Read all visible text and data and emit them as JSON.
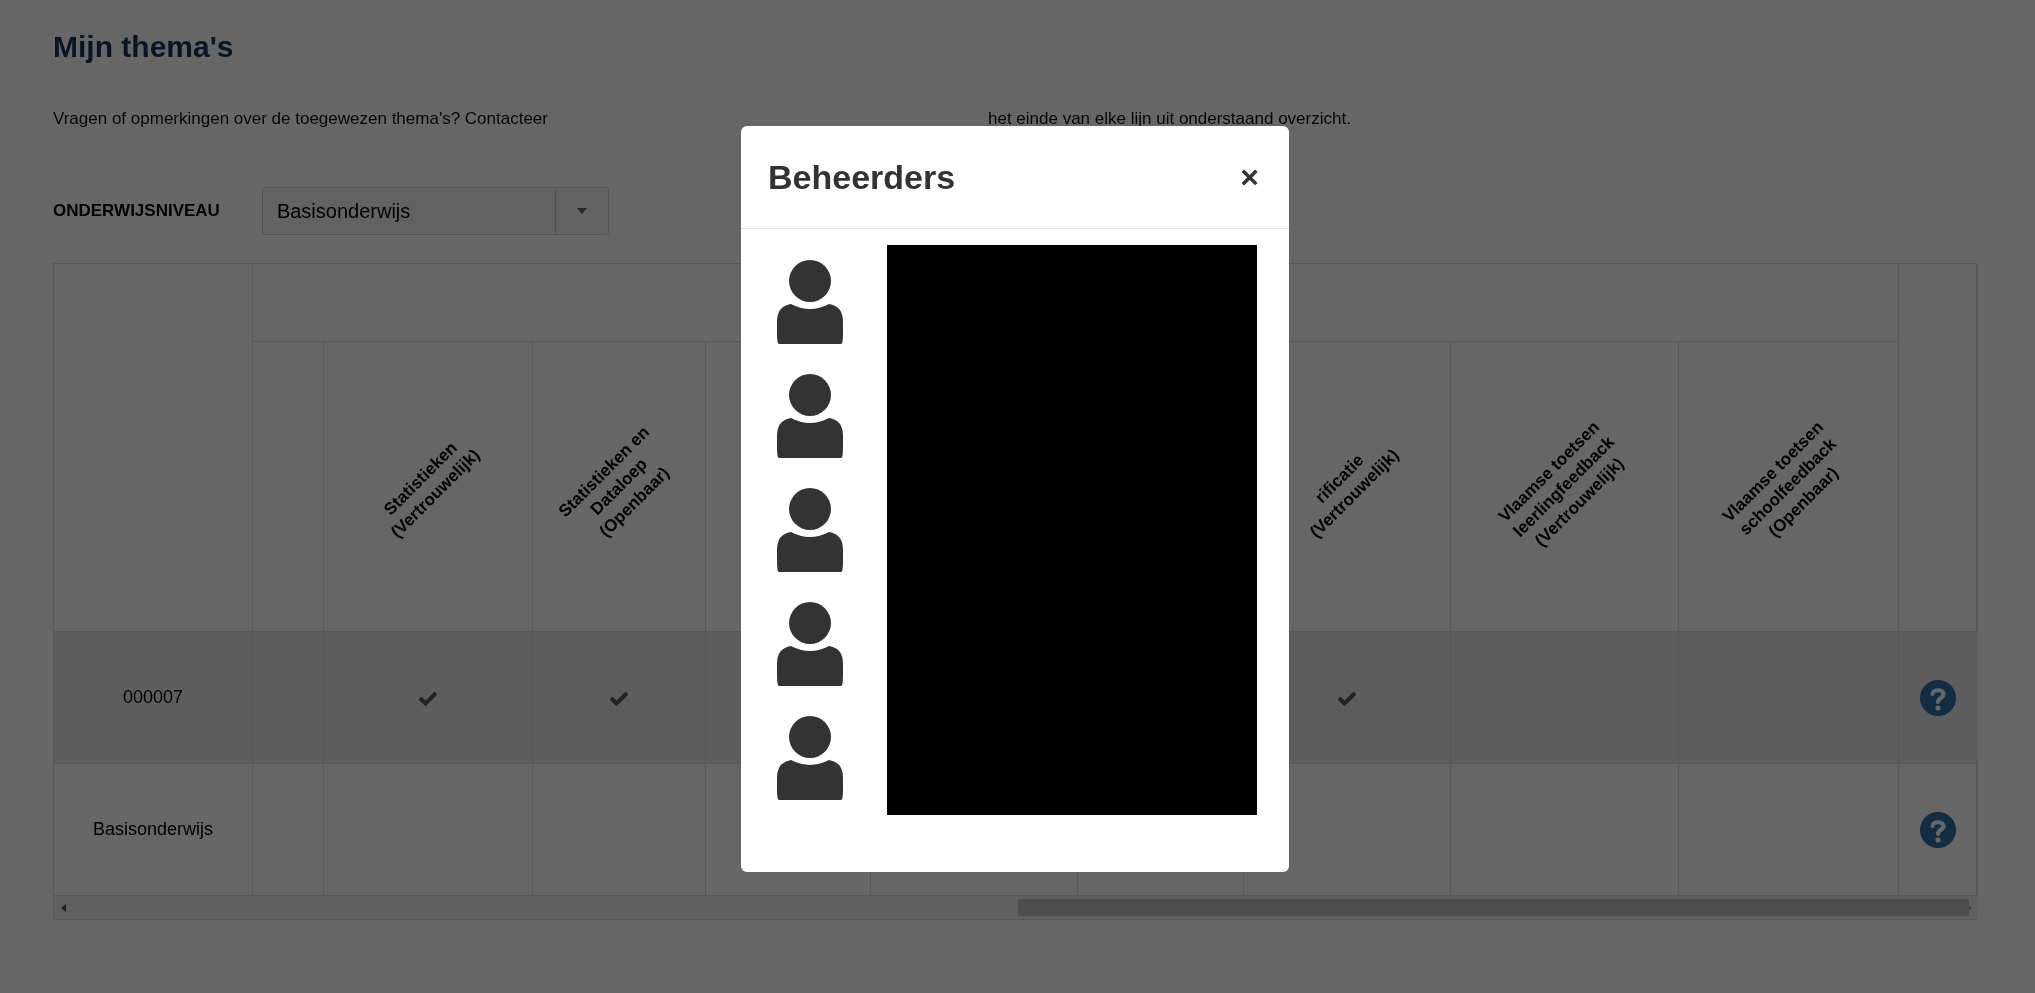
{
  "page": {
    "title": "Mijn thema's",
    "intro_before": "Vragen of opmerkingen over de toegewezen thema's? Contacteer",
    "intro_after": "het einde van elke lijn uit onderstaand overzicht."
  },
  "filter": {
    "label": "ONDERWIJSNIVEAU",
    "value": "Basisonderwijs"
  },
  "table": {
    "columns": [
      {},
      {
        "label": "Statistieken (Vertrouwelijk)"
      },
      {
        "label": "Statistieken en Dataloep (Openbaar)"
      },
      {},
      {},
      {},
      {
        "label": "rificatie (Vertrouwelijk)"
      },
      {
        "label": "Vlaamse toetsen leerlingfeedback (Vertrouwelijk)"
      },
      {
        "label": "Vlaamse toetsen schoolfeedback (Openbaar)"
      }
    ],
    "rows": [
      {
        "name": "000007",
        "cells": [
          {
            "checked": false
          },
          {
            "checked": true
          },
          {
            "checked": true
          },
          null,
          null,
          null,
          {
            "checked": true
          },
          {
            "checked": false
          },
          {
            "checked": false
          }
        ]
      },
      {
        "name": "Basisonderwijs",
        "cells": [
          {
            "checked": false
          },
          {
            "checked": false
          },
          {
            "checked": false
          },
          null,
          null,
          null,
          {
            "checked": false
          },
          {
            "checked": false
          },
          {
            "checked": false
          }
        ]
      }
    ]
  },
  "modal": {
    "title": "Beheerders",
    "close": "×",
    "admins": [
      {
        "redacted": true
      },
      {
        "redacted": true
      },
      {
        "redacted": true
      },
      {
        "redacted": true
      },
      {
        "redacted": true
      }
    ]
  }
}
